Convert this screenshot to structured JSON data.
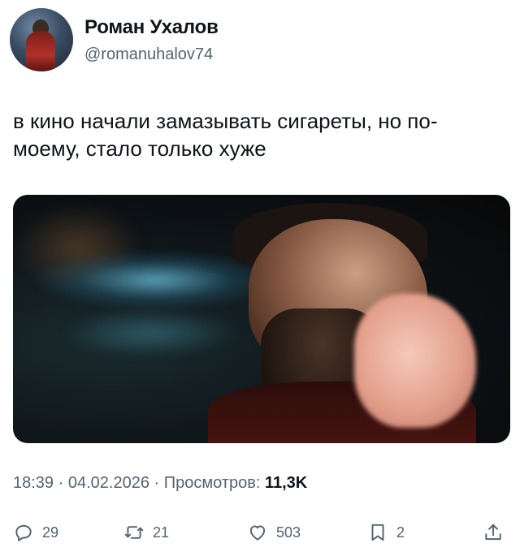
{
  "tweet": {
    "author_name": "Роман Ухалов",
    "author_handle": "@romanuhalov74",
    "text": "в кино начали замазывать сигареты, но по-моему, стало только хуже",
    "meta": {
      "time": "18:39",
      "date": "04.02.2026",
      "views_label": "Просмотров:",
      "views_value": "11,3K",
      "separator": " · "
    },
    "actions": {
      "replies": "29",
      "retweets": "21",
      "likes": "503",
      "bookmarks": "2"
    }
  },
  "icons": [
    "reply-icon",
    "retweet-icon",
    "like-icon",
    "bookmark-icon",
    "share-icon"
  ],
  "colors": {
    "text_primary": "#0f1419",
    "text_secondary": "#536471",
    "background": "#ffffff"
  }
}
